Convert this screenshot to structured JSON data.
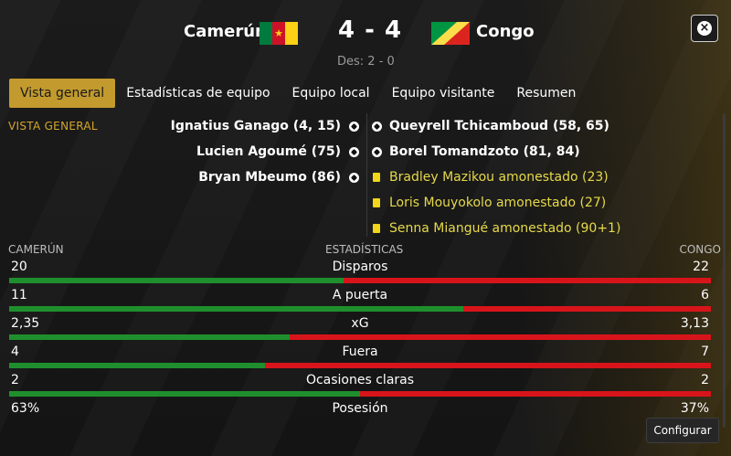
{
  "header": {
    "home_team": "Camerún",
    "away_team": "Congo",
    "score": "4 - 4",
    "penalties": "Des: 2 - 0",
    "home_flag_colors": [
      "#007a3d",
      "#ce1126",
      "#fcd116"
    ],
    "away_flag_colors": [
      "#009543",
      "#fbde4a",
      "#dc241f"
    ]
  },
  "tabs": [
    {
      "label": "Vista general",
      "active": true
    },
    {
      "label": "Estadísticas de equipo",
      "active": false
    },
    {
      "label": "Equipo local",
      "active": false
    },
    {
      "label": "Equipo visitante",
      "active": false
    },
    {
      "label": "Resumen",
      "active": false
    }
  ],
  "section_label": "VISTA GENERAL",
  "events": {
    "home": [
      {
        "text": "Ignatius Ganago (4, 15)",
        "icon": "football-icon"
      },
      {
        "text": "Lucien Agoumé (75)",
        "icon": "football-icon"
      },
      {
        "text": "Bryan Mbeumo (86)",
        "icon": "football-icon"
      }
    ],
    "away": [
      {
        "text": "Queyrell Tchicamboud (58, 65)",
        "icon": "football-icon"
      },
      {
        "text": "Borel Tomandzoto (81, 84)",
        "icon": "football-icon"
      },
      {
        "text": "Bradley Mazikou amonestado (23)",
        "icon": "yellow-card-icon"
      },
      {
        "text": "Loris Mouyokolo amonestado (27)",
        "icon": "yellow-card-icon"
      },
      {
        "text": "Senna Miangué amonestado (90+1)",
        "icon": "yellow-card-icon"
      }
    ]
  },
  "stats_header": {
    "home": "CAMERÚN",
    "center": "ESTADÍSTICAS",
    "away": "CONGO"
  },
  "stats": [
    {
      "name": "Disparos",
      "home": "20",
      "away": "22",
      "home_share": 0.476
    },
    {
      "name": "A puerta",
      "home": "11",
      "away": "6",
      "home_share": 0.647
    },
    {
      "name": "xG",
      "home": "2,35",
      "away": "3,13",
      "home_share": 0.4
    },
    {
      "name": "Fuera",
      "home": "4",
      "away": "7",
      "home_share": 0.364
    },
    {
      "name": "Ocasiones claras",
      "home": "2",
      "away": "2",
      "home_share": 0.5
    },
    {
      "name": "Posesión",
      "home": "63%",
      "away": "37%",
      "home_share": null
    }
  ],
  "configure_label": "Configurar",
  "colors": {
    "accent": "#c29a2e",
    "home_bar": "#1f8f2e",
    "away_bar": "#d8141b",
    "card_text": "#e6d94a"
  }
}
